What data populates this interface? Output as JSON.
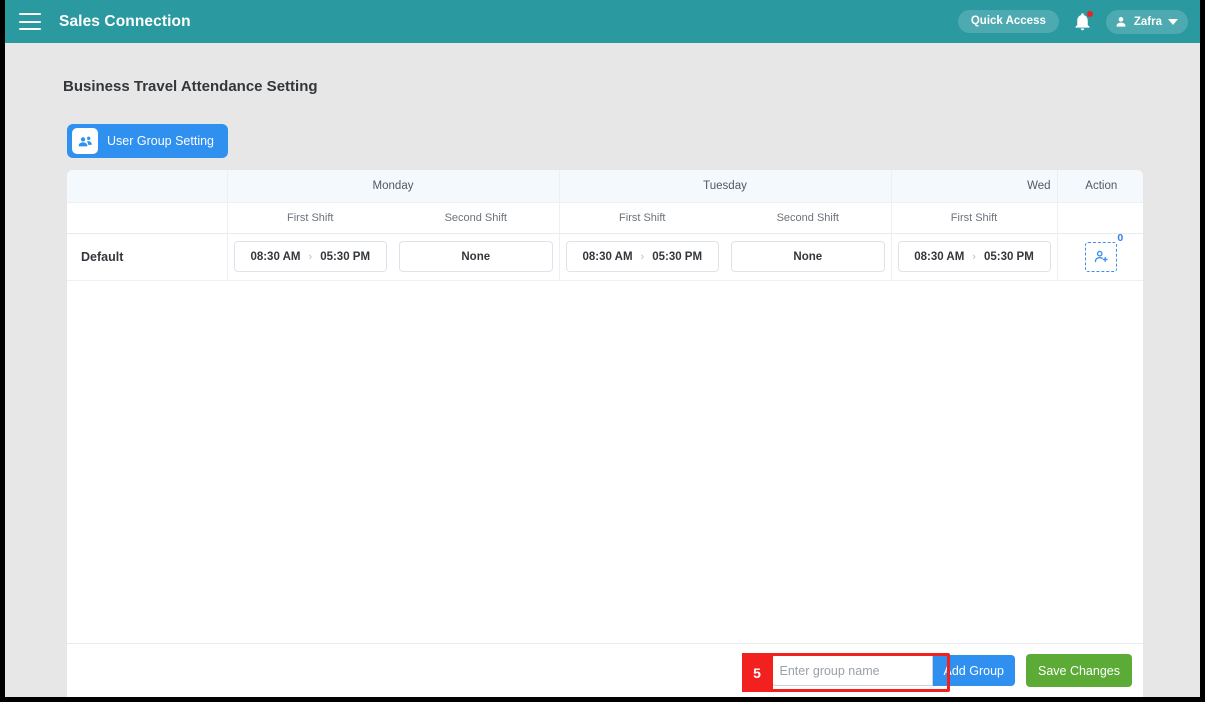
{
  "topbar": {
    "menu_icon": "hamburger-icon",
    "brand": "Sales Connection",
    "quick_access": "Quick Access",
    "bell_icon": "notification-bell-icon",
    "has_notification_dot": true,
    "user_icon": "user-avatar-icon",
    "user_name": "Zafra",
    "chevron_icon": "chevron-down-icon",
    "bar_color": "#2a99a0"
  },
  "page": {
    "title": "Business Travel Attendance Setting",
    "user_group_setting_button": {
      "label": "User Group Setting",
      "icon": "user-group-icon",
      "color": "#2f90ef"
    }
  },
  "table": {
    "day_headers": [
      {
        "label": "",
        "span": 1
      },
      {
        "label": "Monday",
        "span": 2
      },
      {
        "label": "Tuesday",
        "span": 2
      },
      {
        "label": "Wed",
        "span": 1
      },
      {
        "label": "Action",
        "span": 1
      }
    ],
    "shift_headers": [
      "",
      "First Shift",
      "Second Shift",
      "First Shift",
      "Second Shift",
      "First Shift",
      ""
    ],
    "rows": [
      {
        "group": "Default",
        "cells": [
          {
            "type": "range",
            "start": "08:30 AM",
            "arrow": "›",
            "end": "05:30 PM"
          },
          {
            "type": "none",
            "text": "None"
          },
          {
            "type": "range",
            "start": "08:30 AM",
            "arrow": "›",
            "end": "05:30 PM"
          },
          {
            "type": "none",
            "text": "None"
          },
          {
            "type": "range",
            "start": "08:30 AM",
            "arrow": "›",
            "end": "05:30 PM"
          }
        ],
        "action": {
          "icon": "add-user-icon",
          "count": "0"
        }
      }
    ]
  },
  "footer": {
    "group_name_value": "",
    "group_name_placeholder": "Enter group name",
    "add_group_label": "Add Group",
    "save_changes_label": "Save Changes",
    "add_group_color": "#2f90ef",
    "save_color": "#5cab36"
  },
  "annotation": {
    "number": "5",
    "color": "#f32020"
  }
}
